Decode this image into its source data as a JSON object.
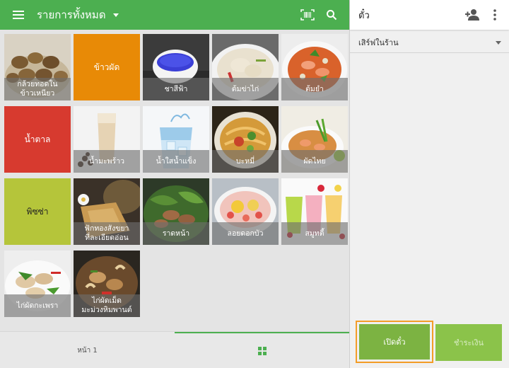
{
  "appbar": {
    "title": "รายการทั้งหมด",
    "menu_icon": "menu-icon",
    "dropdown_icon": "caret-down-icon",
    "barcode_icon": "barcode-icon",
    "search_icon": "search-icon",
    "color": "#4caf50"
  },
  "items": [
    {
      "label": "กล้วยทอดใน\nข้าวเหนียว",
      "kind": "photo"
    },
    {
      "label": "ข้าวผัด",
      "kind": "color",
      "color": "#e88a06"
    },
    {
      "label": "ชาสีฟ้า",
      "kind": "photo"
    },
    {
      "label": "ต้มข่าไก่",
      "kind": "photo"
    },
    {
      "label": "ต้มยำ",
      "kind": "photo"
    },
    {
      "label": "น้ำตาล",
      "kind": "color",
      "color": "#d73a2f"
    },
    {
      "label": "น้ำมะพร้าว",
      "kind": "photo"
    },
    {
      "label": "น้ำใสน้ำแข็ง",
      "kind": "photo"
    },
    {
      "label": "บะหมี่",
      "kind": "photo"
    },
    {
      "label": "ผัดไทย",
      "kind": "photo"
    },
    {
      "label": "พิซซ่า",
      "kind": "color",
      "color": "#b5c53a"
    },
    {
      "label": "ฟักทองสังขยา\nที่ละเอียดอ่อน",
      "kind": "photo"
    },
    {
      "label": "ราดหน้า",
      "kind": "photo"
    },
    {
      "label": "ลอยดอกบัว",
      "kind": "photo"
    },
    {
      "label": "สมูทตี้",
      "kind": "photo"
    },
    {
      "label": "ไก่ผัดกะเพรา",
      "kind": "photo"
    },
    {
      "label": "ไก่ผัดเม็ด\nมะม่วงหิมพานต์",
      "kind": "photo"
    }
  ],
  "pager": {
    "page_label": "หน้า 1",
    "grid_icon": "grid-icon"
  },
  "ticket": {
    "title": "ตั๋ว",
    "add_customer_icon": "add-person-icon",
    "more_icon": "more-vert-icon",
    "dining_option": "เสิร์ฟในร้าน",
    "open_tickets_label": "เปิดตั๋ว",
    "charge_label": "ชำระเงิน",
    "highlight_color": "#f39d28"
  }
}
